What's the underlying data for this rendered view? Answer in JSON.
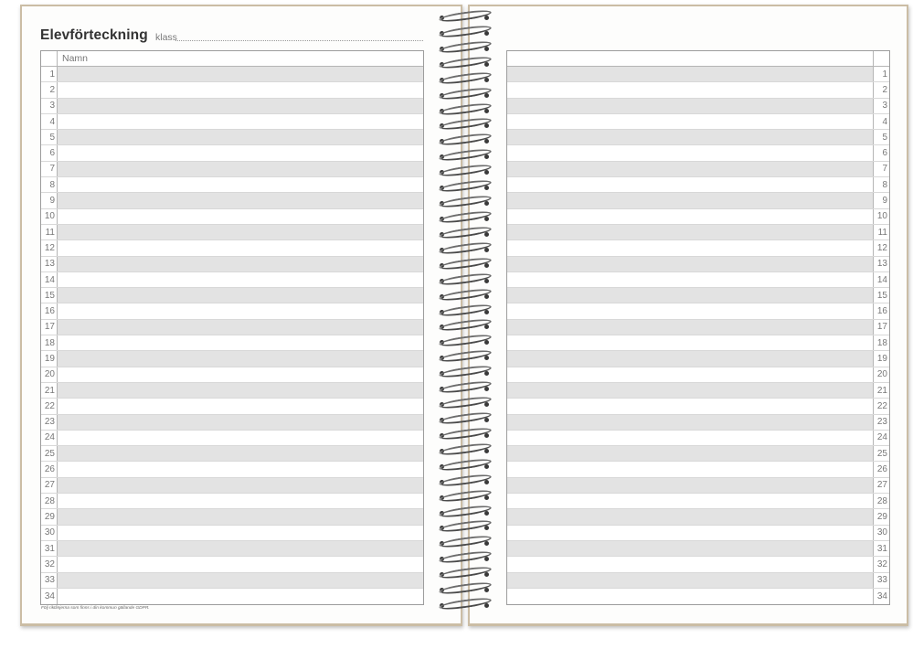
{
  "left_page": {
    "title": "Elevförteckning",
    "klass_label": "klass",
    "column_header": "Namn",
    "footnote": "Följ riktlinjerna som finns i din kommun gällande GDPR."
  },
  "rows": [
    "1",
    "2",
    "3",
    "4",
    "5",
    "6",
    "7",
    "8",
    "9",
    "10",
    "11",
    "12",
    "13",
    "14",
    "15",
    "16",
    "17",
    "18",
    "19",
    "20",
    "21",
    "22",
    "23",
    "24",
    "25",
    "26",
    "27",
    "28",
    "29",
    "30",
    "31",
    "32",
    "33",
    "34"
  ],
  "colors": {
    "cover": "#cbbda5",
    "shaded_row": "#e3e3e3",
    "page": "#fdfdfc"
  },
  "spiral": {
    "coil_count": 39
  }
}
